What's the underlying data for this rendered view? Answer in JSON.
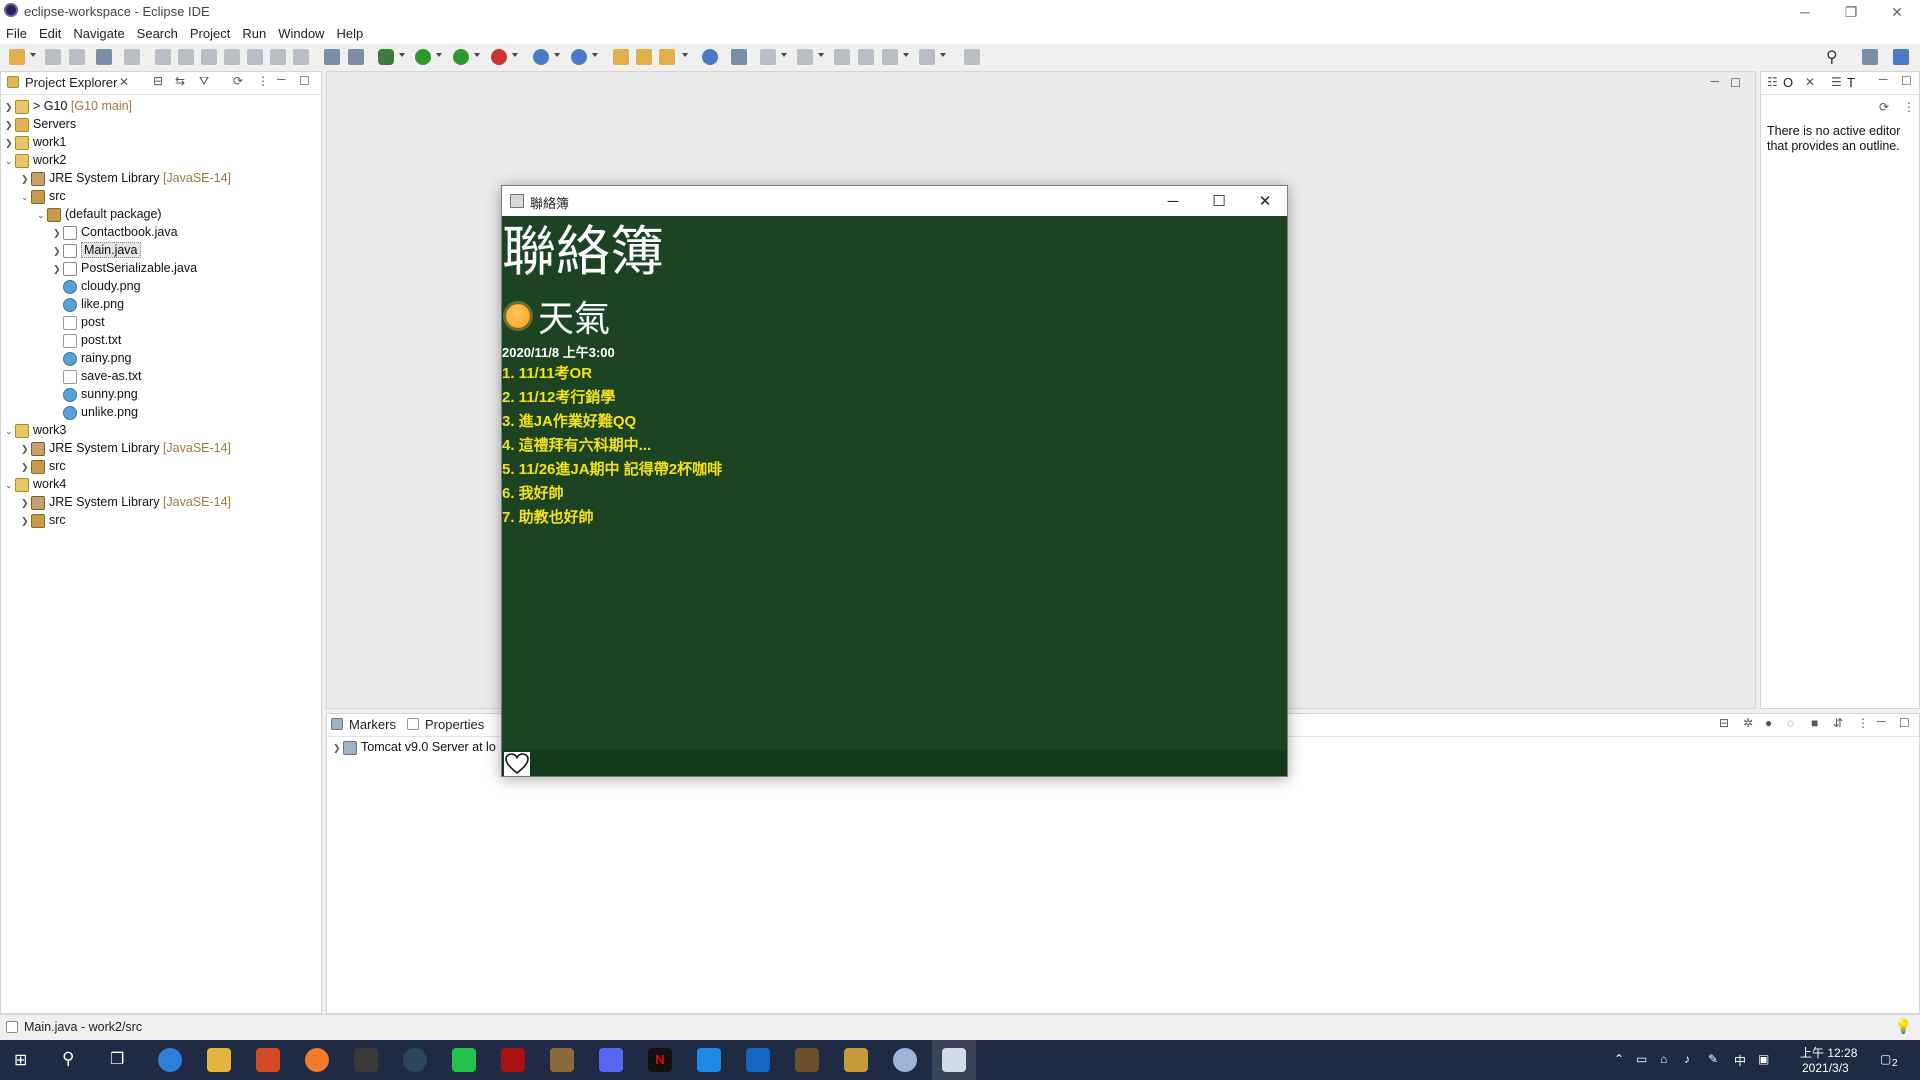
{
  "window": {
    "title": "eclipse-workspace - Eclipse IDE"
  },
  "menu": [
    "File",
    "Edit",
    "Navigate",
    "Search",
    "Project",
    "Run",
    "Window",
    "Help"
  ],
  "project_explorer": {
    "tab_label": "Project Explorer",
    "items": [
      {
        "text": "> G10",
        "deco": "[G10 main]",
        "icon": "proj"
      },
      {
        "text": "Servers",
        "deco": "",
        "icon": "folder"
      },
      {
        "text": "work1",
        "deco": "",
        "icon": "proj"
      },
      {
        "text": "work2",
        "deco": "",
        "icon": "proj"
      },
      {
        "text": "JRE System Library",
        "deco": "[JavaSE-14]",
        "icon": "lib"
      },
      {
        "text": "src",
        "deco": "",
        "icon": "pkg"
      },
      {
        "text": "(default package)",
        "deco": "",
        "icon": "pkg"
      },
      {
        "text": "Contactbook.java",
        "deco": "",
        "icon": "java"
      },
      {
        "text": "Main.java",
        "deco": "",
        "icon": "java"
      },
      {
        "text": "PostSerializable.java",
        "deco": "",
        "icon": "java"
      },
      {
        "text": "cloudy.png",
        "deco": "",
        "icon": "img"
      },
      {
        "text": "like.png",
        "deco": "",
        "icon": "img"
      },
      {
        "text": "post",
        "deco": "",
        "icon": "file"
      },
      {
        "text": "post.txt",
        "deco": "",
        "icon": "file"
      },
      {
        "text": "rainy.png",
        "deco": "",
        "icon": "img"
      },
      {
        "text": "save-as.txt",
        "deco": "",
        "icon": "file"
      },
      {
        "text": "sunny.png",
        "deco": "",
        "icon": "img"
      },
      {
        "text": "unlike.png",
        "deco": "",
        "icon": "img"
      },
      {
        "text": "work3",
        "deco": "",
        "icon": "proj"
      },
      {
        "text": "JRE System Library",
        "deco": "[JavaSE-14]",
        "icon": "lib"
      },
      {
        "text": "src",
        "deco": "",
        "icon": "pkg"
      },
      {
        "text": "work4",
        "deco": "",
        "icon": "proj"
      },
      {
        "text": "JRE System Library",
        "deco": "[JavaSE-14]",
        "icon": "lib"
      },
      {
        "text": "src",
        "deco": "",
        "icon": "pkg"
      }
    ]
  },
  "outline": {
    "tab1": "O",
    "tab2": "T",
    "message": "There is no active editor that provides an outline."
  },
  "bottom_panel": {
    "tab_markers": "Markers",
    "tab_properties": "Properties",
    "server_row": "Tomcat v9.0 Server at lo"
  },
  "dialog": {
    "title": "聯絡簿",
    "heading": "聯絡簿",
    "weather": "天氣",
    "date": "2020/11/8 上午3:00",
    "posts": [
      "1. 11/11考OR",
      "2. 11/12考行銷學",
      "3. 進JA作業好難QQ",
      "4. 這禮拜有六科期中...",
      "5. 11/26進JA期中 記得帶2杯咖啡",
      "6. 我好帥",
      "7. 助教也好帥"
    ]
  },
  "statusbar": {
    "text": "Main.java - work2/src"
  },
  "taskbar": {
    "time": "上午 12:28",
    "date": "2021/3/3",
    "ime": "中",
    "notif": "2"
  }
}
